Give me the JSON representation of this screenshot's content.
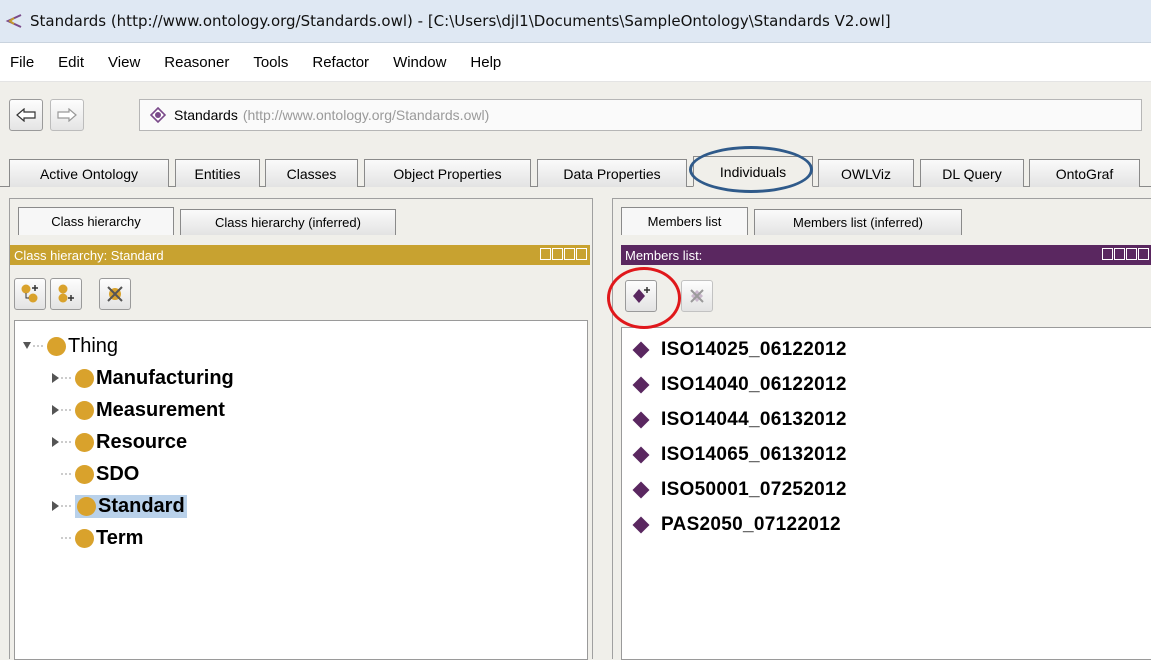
{
  "window": {
    "title": "Standards (http://www.ontology.org/Standards.owl) - [C:\\Users\\djl1\\Documents\\SampleOntology\\Standards V2.owl]"
  },
  "menu": [
    "File",
    "Edit",
    "View",
    "Reasoner",
    "Tools",
    "Refactor",
    "Window",
    "Help"
  ],
  "address": {
    "name": "Standards",
    "url": "(http://www.ontology.org/Standards.owl)"
  },
  "tabs": [
    "Active Ontology",
    "Entities",
    "Classes",
    "Object Properties",
    "Data Properties",
    "Individuals",
    "OWLViz",
    "DL Query",
    "OntoGraf"
  ],
  "active_tab": "Individuals",
  "left_panel": {
    "tabs": [
      "Class hierarchy",
      "Class hierarchy (inferred)"
    ],
    "header": "Class hierarchy: Standard",
    "tree": [
      {
        "label": "Thing"
      },
      {
        "label": "Manufacturing"
      },
      {
        "label": "Measurement"
      },
      {
        "label": "Resource"
      },
      {
        "label": "SDO"
      },
      {
        "label": "Standard"
      },
      {
        "label": "Term"
      }
    ]
  },
  "right_panel": {
    "tabs": [
      "Members list",
      "Members list (inferred)"
    ],
    "header": "Members list:",
    "members": [
      "ISO14025_06122012",
      "ISO14040_06122012",
      "ISO14044_06132012",
      "ISO14065_06132012",
      "ISO50001_07252012",
      "PAS2050_07122012"
    ]
  },
  "colors": {
    "class_header": "#c8a230",
    "members_header": "#5a2760",
    "class_dot": "#d9a22c",
    "individual": "#5a2760",
    "highlight_ellipse": "#2f5a8a",
    "highlight_circle": "#e0181b"
  },
  "icons": [
    "back-arrow-icon",
    "forward-arrow-icon",
    "ontology-icon",
    "add-subclass-icon",
    "add-sibling-class-icon",
    "delete-class-icon",
    "add-individual-icon",
    "delete-individual-icon"
  ]
}
